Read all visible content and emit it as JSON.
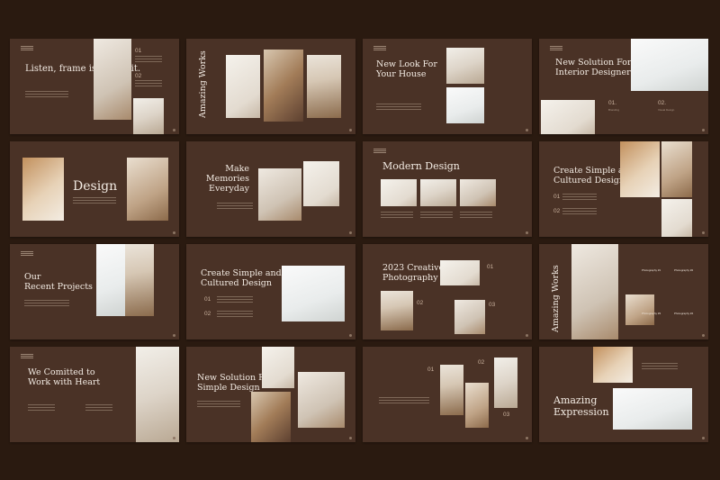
{
  "slides": {
    "s1": {
      "title": "Listen, frame is the limit.",
      "n1": "01",
      "n2": "02"
    },
    "s2": {
      "title": "Amazing Works"
    },
    "s3": {
      "title": "New Look For Your House"
    },
    "s4": {
      "title": "New Solution For Interior Designers",
      "n1": "01.",
      "n2": "02.",
      "l1": "Branding",
      "l2": "Visual Design"
    },
    "s5": {
      "title": "Design"
    },
    "s6": {
      "title": "Make Memories Everyday"
    },
    "s7": {
      "title": "Modern Design"
    },
    "s8": {
      "title": "Create Simple and Cultured Design",
      "n1": "01",
      "n2": "02"
    },
    "s9": {
      "title": "Our Recent Projects"
    },
    "s10": {
      "title": "Create Simple and Cultured Design",
      "n1": "01",
      "n2": "02"
    },
    "s11": {
      "title": "2023 Creative Photography",
      "n1": "01",
      "n2": "02",
      "n3": "03"
    },
    "s12": {
      "title": "Amazing Works",
      "items": [
        "Photography #1",
        "Photography #2",
        "Photography #3",
        "Photography #4"
      ]
    },
    "s13": {
      "title": "We Comitted to Work with Heart"
    },
    "s14": {
      "title": "New Solution For Simple Design"
    },
    "s15": {
      "n1": "01",
      "n2": "02",
      "n3": "03"
    },
    "s16": {
      "title": "Amazing Expression"
    }
  }
}
